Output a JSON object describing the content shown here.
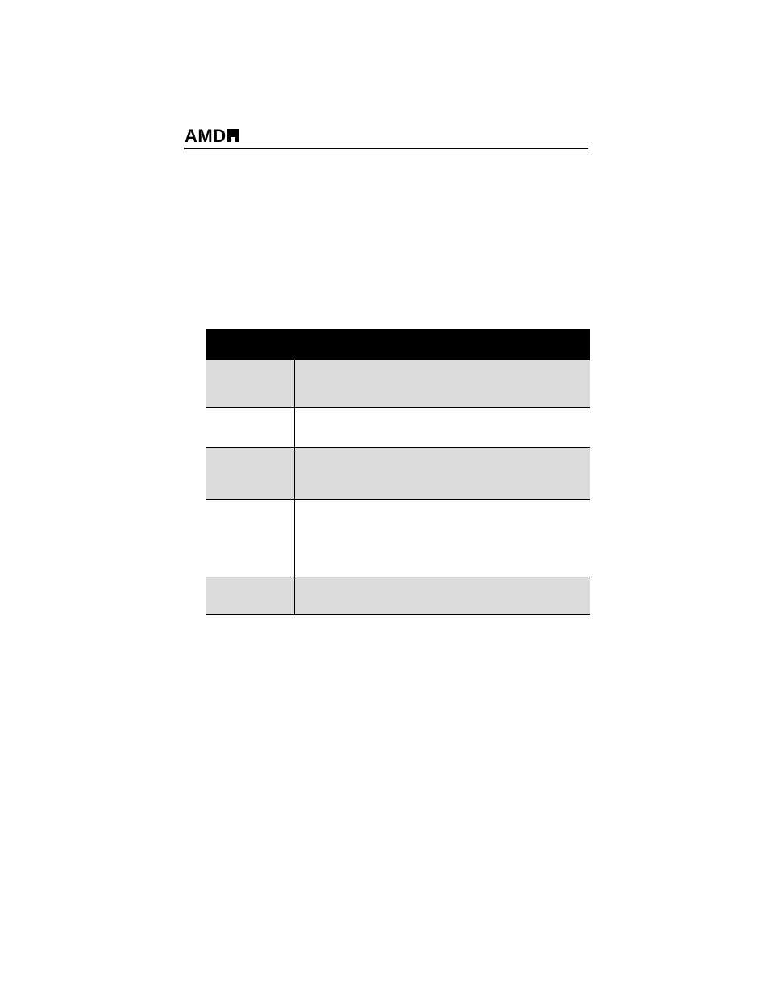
{
  "header": {
    "logo_text": "AMD"
  },
  "table": {
    "header": {
      "col_a": "",
      "col_b": ""
    },
    "rows": [
      {
        "shaded": true,
        "height_class": "h59",
        "col_a": "",
        "col_b": ""
      },
      {
        "shaded": false,
        "height_class": "h49",
        "col_a": "",
        "col_b": ""
      },
      {
        "shaded": true,
        "height_class": "h65",
        "col_a": "",
        "col_b": ""
      },
      {
        "shaded": false,
        "height_class": "h96",
        "col_a": "",
        "col_b": ""
      },
      {
        "shaded": true,
        "height_class": "h46",
        "col_a": "",
        "col_b": ""
      }
    ]
  }
}
